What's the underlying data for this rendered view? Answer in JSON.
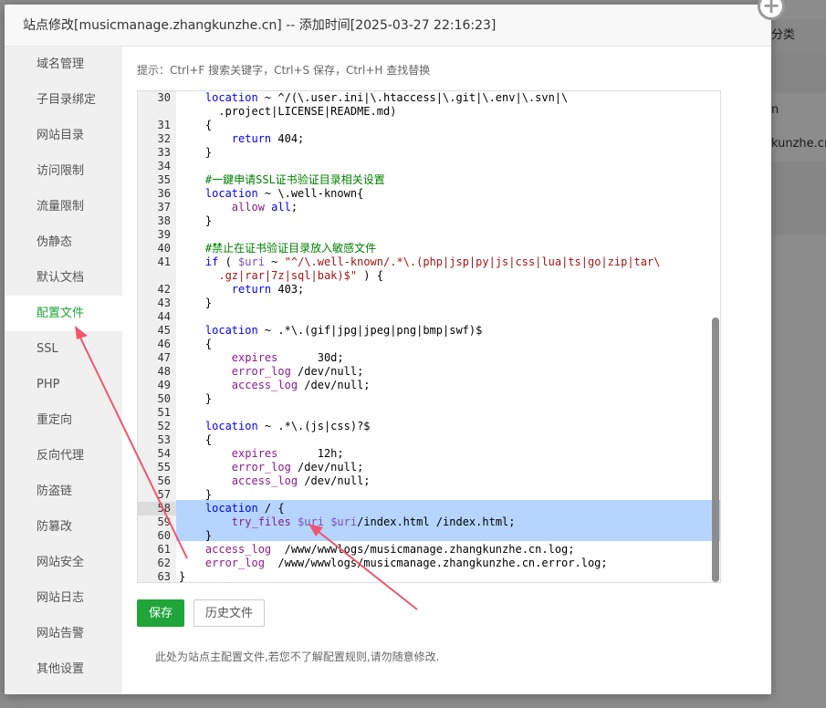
{
  "background": {
    "header_text": "分类",
    "row1_text": "n",
    "row2_text": "kunzhe.cn"
  },
  "modal": {
    "title": "站点修改[musicmanage.zhangkunzhe.cn] -- 添加时间[2025-03-27 22:16:23]",
    "close_glyph": "+",
    "hint": "提示：Ctrl+F 搜索关键字，Ctrl+S 保存，Ctrl+H 查找替换",
    "save_label": "保存",
    "history_label": "历史文件",
    "note": "此处为站点主配置文件,若您不了解配置规则,请勿随意修改."
  },
  "sidebar": {
    "items": [
      {
        "label": "域名管理",
        "active": false
      },
      {
        "label": "子目录绑定",
        "active": false
      },
      {
        "label": "网站目录",
        "active": false
      },
      {
        "label": "访问限制",
        "active": false
      },
      {
        "label": "流量限制",
        "active": false
      },
      {
        "label": "伪静态",
        "active": false
      },
      {
        "label": "默认文档",
        "active": false
      },
      {
        "label": "配置文件",
        "active": true
      },
      {
        "label": "SSL",
        "active": false
      },
      {
        "label": "PHP",
        "active": false
      },
      {
        "label": "重定向",
        "active": false
      },
      {
        "label": "反向代理",
        "active": false
      },
      {
        "label": "防盗链",
        "active": false
      },
      {
        "label": "防篡改",
        "active": false
      },
      {
        "label": "网站安全",
        "active": false
      },
      {
        "label": "网站日志",
        "active": false
      },
      {
        "label": "网站告警",
        "active": false
      },
      {
        "label": "其他设置",
        "active": false
      }
    ]
  },
  "editor": {
    "lines": [
      {
        "n": "30",
        "html": "    <span class='kw'>location</span> ~ ^/(\\.user.ini|\\.htaccess|\\.git|\\.env|\\.svn|\\"
      },
      {
        "n": "",
        "html": "      .project|LICENSE|README.md)"
      },
      {
        "n": "31",
        "html": "    {"
      },
      {
        "n": "32",
        "html": "        <span class='kw'>return</span> 404;"
      },
      {
        "n": "33",
        "html": "    }"
      },
      {
        "n": "34",
        "html": ""
      },
      {
        "n": "35",
        "html": "    <span class='cm'>#一鍵申请SSL证书验证目录相关设置</span>"
      },
      {
        "n": "36",
        "html": "    <span class='kw'>location</span> ~ \\.well-known{"
      },
      {
        "n": "37",
        "html": "        <span class='dir'>allow</span> <span class='kw'>all</span>;"
      },
      {
        "n": "38",
        "html": "    }"
      },
      {
        "n": "39",
        "html": ""
      },
      {
        "n": "40",
        "html": "    <span class='cm'>#禁止在证书验证目录放入敏感文件</span>"
      },
      {
        "n": "41",
        "html": "    <span class='kw'>if</span> ( <span class='var'>$uri</span> ~ <span class='str'>\"^/\\.well-known/.*\\.(php|jsp|py|js|css|lua|ts|go|zip|tar\\</span>"
      },
      {
        "n": "",
        "html": "      <span class='str'>.gz|rar|7z|sql|bak)$\"</span> ) {"
      },
      {
        "n": "42",
        "html": "        <span class='kw'>return</span> 403;"
      },
      {
        "n": "43",
        "html": "    }"
      },
      {
        "n": "44",
        "html": ""
      },
      {
        "n": "45",
        "html": "    <span class='kw'>location</span> ~ .*\\.(gif|jpg|jpeg|png|bmp|swf)$"
      },
      {
        "n": "46",
        "html": "    {"
      },
      {
        "n": "47",
        "html": "        <span class='dir'>expires</span>      30d;"
      },
      {
        "n": "48",
        "html": "        <span class='dir'>error_log</span> /dev/null;"
      },
      {
        "n": "49",
        "html": "        <span class='dir'>access_log</span> /dev/null;"
      },
      {
        "n": "50",
        "html": "    }"
      },
      {
        "n": "51",
        "html": ""
      },
      {
        "n": "52",
        "html": "    <span class='kw'>location</span> ~ .*\\.(js|css)?$"
      },
      {
        "n": "53",
        "html": "    {"
      },
      {
        "n": "54",
        "html": "        <span class='dir'>expires</span>      12h;"
      },
      {
        "n": "55",
        "html": "        <span class='dir'>error_log</span> /dev/null;"
      },
      {
        "n": "56",
        "html": "        <span class='dir'>access_log</span> /dev/null;"
      },
      {
        "n": "57",
        "html": "    }"
      },
      {
        "n": "58",
        "html": "    <span class='kw'>location</span> / {",
        "sel": true,
        "active": true
      },
      {
        "n": "59",
        "html": "        <span class='dir'>try_files</span> <span class='var'>$uri</span> <span class='var'>$uri</span>/index.html /index.html;",
        "sel": true
      },
      {
        "n": "60",
        "html": "    }",
        "sel": true
      },
      {
        "n": "61",
        "html": "    <span class='dir'>access_log</span>  /www/wwwlogs/musicmanage.zhangkunzhe.cn.log;"
      },
      {
        "n": "62",
        "html": "    <span class='dir'>error_log</span>  /www/wwwlogs/musicmanage.zhangkunzhe.cn.error.log;"
      },
      {
        "n": "63",
        "html": "}"
      }
    ]
  }
}
